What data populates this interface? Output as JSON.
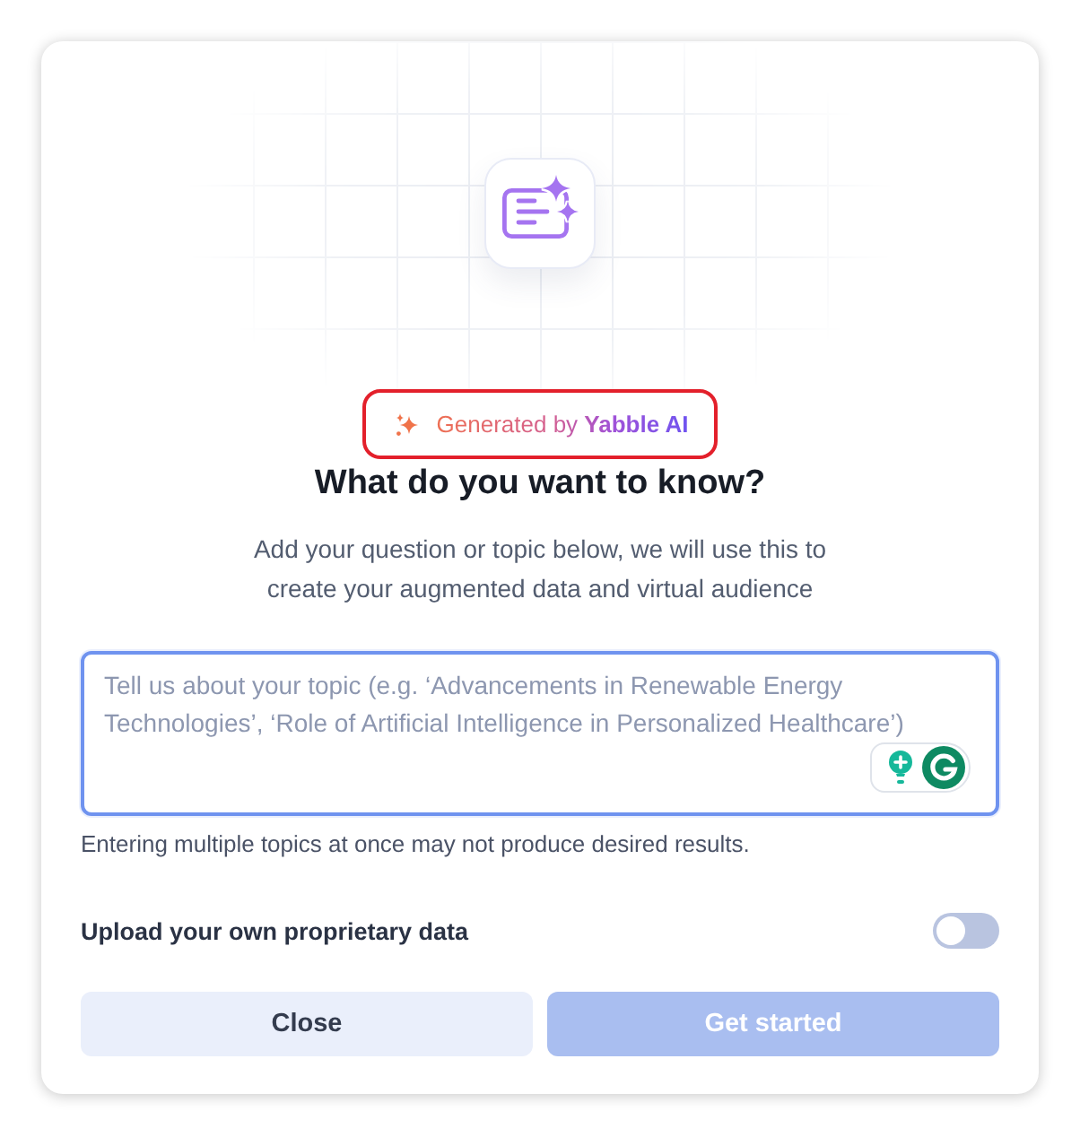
{
  "badge": {
    "text": "Generated by **Yabble AI**",
    "highlighted": true
  },
  "heading": "What do you want to know?",
  "subtitle": "Add your question or topic below, we will use this to create your augmented data and virtual audience",
  "topic_field": {
    "placeholder": "Tell us about your topic (e.g. ‘Advancements in Renewable Energy Technologies’, ‘Role of Artificial Intelligence in Personalized Healthcare’)",
    "focused": true
  },
  "hint": "Entering multiple topics at once may not produce desired results.",
  "upload_toggle": {
    "label": "Upload your own proprietary data",
    "on": false
  },
  "buttons": [
    {
      "label": "Close",
      "kind": "secondary",
      "disabled": false
    },
    {
      "label": "Get started",
      "kind": "primary",
      "disabled": true
    }
  ]
}
